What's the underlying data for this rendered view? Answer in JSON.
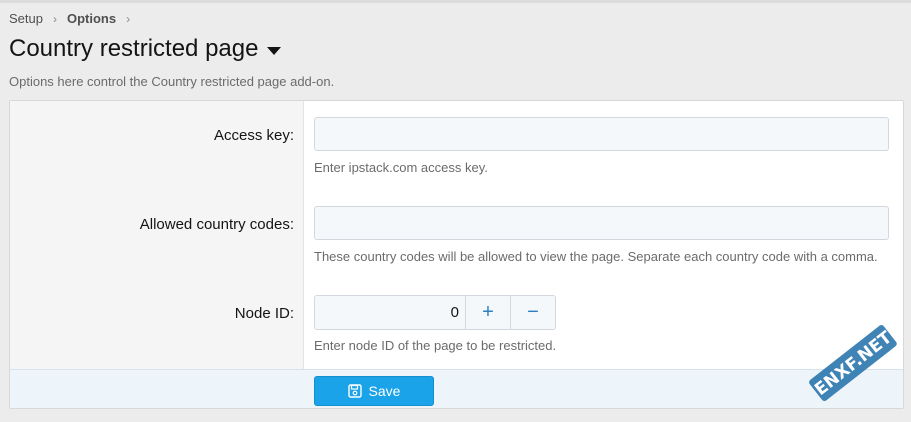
{
  "breadcrumb": {
    "items": [
      "Setup",
      "Options"
    ]
  },
  "page": {
    "title": "Country restricted page",
    "description": "Options here control the Country restricted page add-on."
  },
  "form": {
    "access_key": {
      "label": "Access key:",
      "value": "",
      "hint": "Enter ipstack.com access key."
    },
    "allowed_codes": {
      "label": "Allowed country codes:",
      "value": "",
      "hint": "These country codes will be allowed to view the page. Separate each country code with a comma."
    },
    "node_id": {
      "label": "Node ID:",
      "value": "0",
      "plus": "+",
      "minus": "−",
      "hint": "Enter node ID of the page to be restricted."
    }
  },
  "footer": {
    "save_label": "Save"
  },
  "watermark": {
    "text": "ENXF.NET"
  },
  "colors": {
    "accent": "#1aa3e8",
    "stepper_icon": "#2a7fc1"
  },
  "icons": {
    "separator": "chevron-right-icon",
    "title_dropdown": "caret-down-icon",
    "save": "floppy-disk-icon"
  }
}
